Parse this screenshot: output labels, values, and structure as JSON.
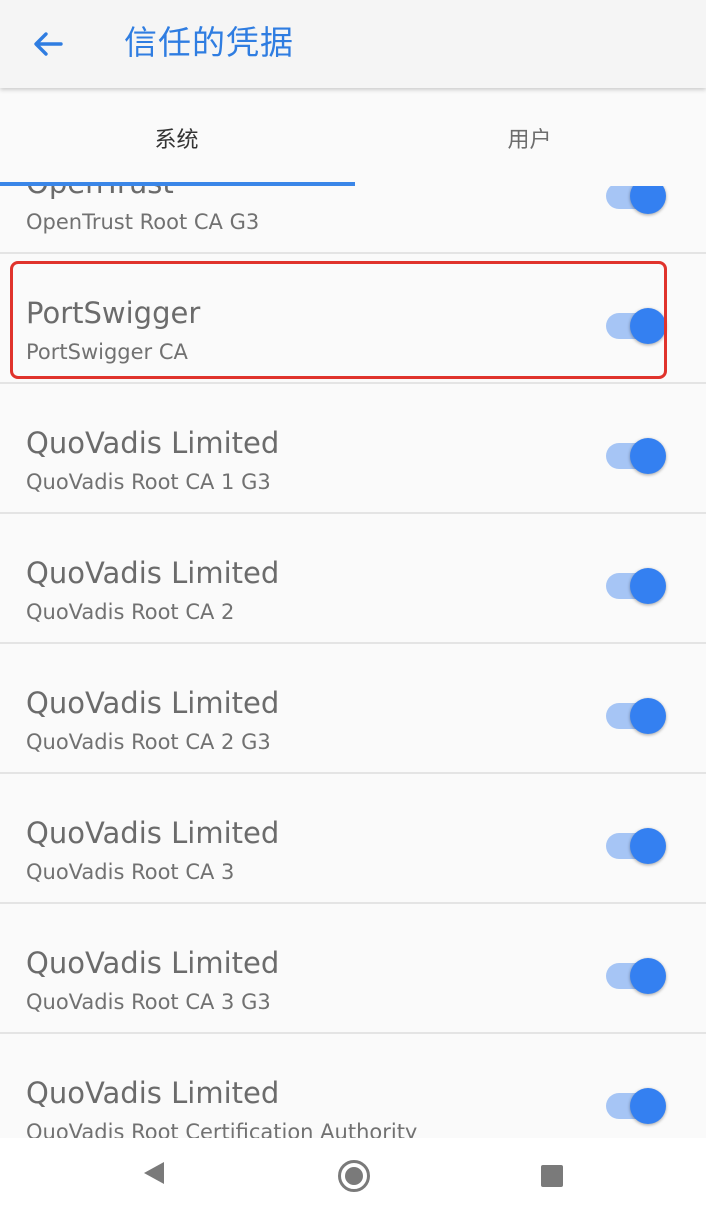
{
  "app_bar": {
    "title": "信任的凭据",
    "back_icon": "arrow-left-icon",
    "accent_color": "#2f7de1"
  },
  "tabs": [
    {
      "label": "系统",
      "selected": true
    },
    {
      "label": "用户",
      "selected": false
    }
  ],
  "certificates": [
    {
      "org": "OpenTrust",
      "name": "OpenTrust Root CA G3",
      "enabled": true
    },
    {
      "org": "PortSwigger",
      "name": "PortSwigger CA",
      "enabled": true,
      "highlighted": true
    },
    {
      "org": "QuoVadis Limited",
      "name": "QuoVadis Root CA 1 G3",
      "enabled": true
    },
    {
      "org": "QuoVadis Limited",
      "name": "QuoVadis Root CA 2",
      "enabled": true
    },
    {
      "org": "QuoVadis Limited",
      "name": "QuoVadis Root CA 2 G3",
      "enabled": true
    },
    {
      "org": "QuoVadis Limited",
      "name": "QuoVadis Root CA 3",
      "enabled": true
    },
    {
      "org": "QuoVadis Limited",
      "name": "QuoVadis Root CA 3 G3",
      "enabled": true
    },
    {
      "org": "QuoVadis Limited",
      "name": "QuoVadis Root Certification Authority",
      "enabled": true
    }
  ],
  "switch_colors": {
    "track": "#a6c5f5",
    "thumb": "#3480f1"
  },
  "highlight_color": "#e0332c",
  "nav_bar": {
    "back_icon": "nav-back-icon",
    "home_icon": "nav-home-icon",
    "recents_icon": "nav-recents-icon"
  }
}
